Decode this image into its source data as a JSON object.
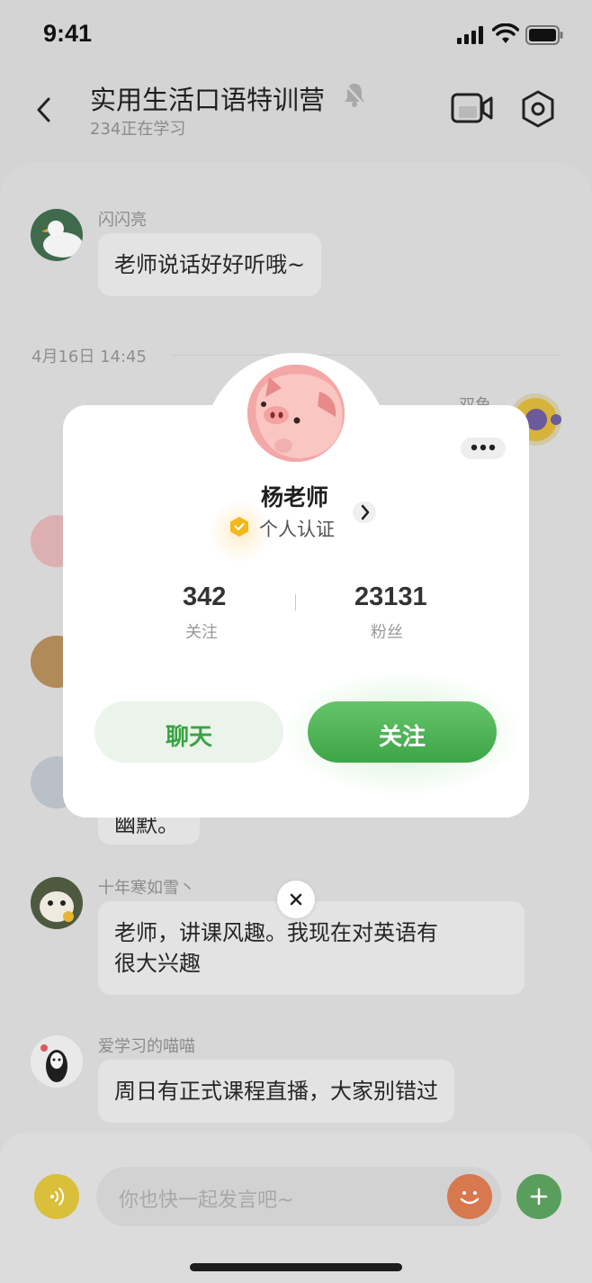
{
  "status_bar": {
    "time": "9:41"
  },
  "header": {
    "title": "实用生活口语特训营",
    "subtitle": "234正在学习",
    "icons": [
      "back-icon",
      "bell-mute-icon",
      "video-call-icon",
      "settings-icon"
    ]
  },
  "messages": [
    {
      "sender": "闪闪亮",
      "text": "老师说话好好听哦~"
    },
    {
      "sender": "十年寒如雪丶",
      "text_lines": [
        "老师，讲课风趣。我现在对英语有",
        "很大兴趣"
      ]
    },
    {
      "sender": "爱学习的喵喵",
      "text": "周日有正式课程直播，大家别错过"
    }
  ],
  "partial": {
    "sender_right": "双鱼",
    "bubble_fragment": "幽默。"
  },
  "date_divider": "4月16日  14:45",
  "input": {
    "placeholder": "你也快一起发言吧~"
  },
  "profile_card": {
    "name": "杨老师",
    "verification": "个人认证",
    "stats": [
      {
        "value": "342",
        "label": "关注"
      },
      {
        "value": "23131",
        "label": "粉丝"
      }
    ],
    "chat_button": "聊天",
    "follow_button": "关注"
  },
  "colors": {
    "accent_green": "#3ea547",
    "chat_button_bg": "#ebf4ea",
    "verify_gold": "#f4b71c",
    "voice_yellow": "#d9bf3a",
    "emoji_orange": "#d8784f",
    "plus_green": "#5a9e5d"
  }
}
